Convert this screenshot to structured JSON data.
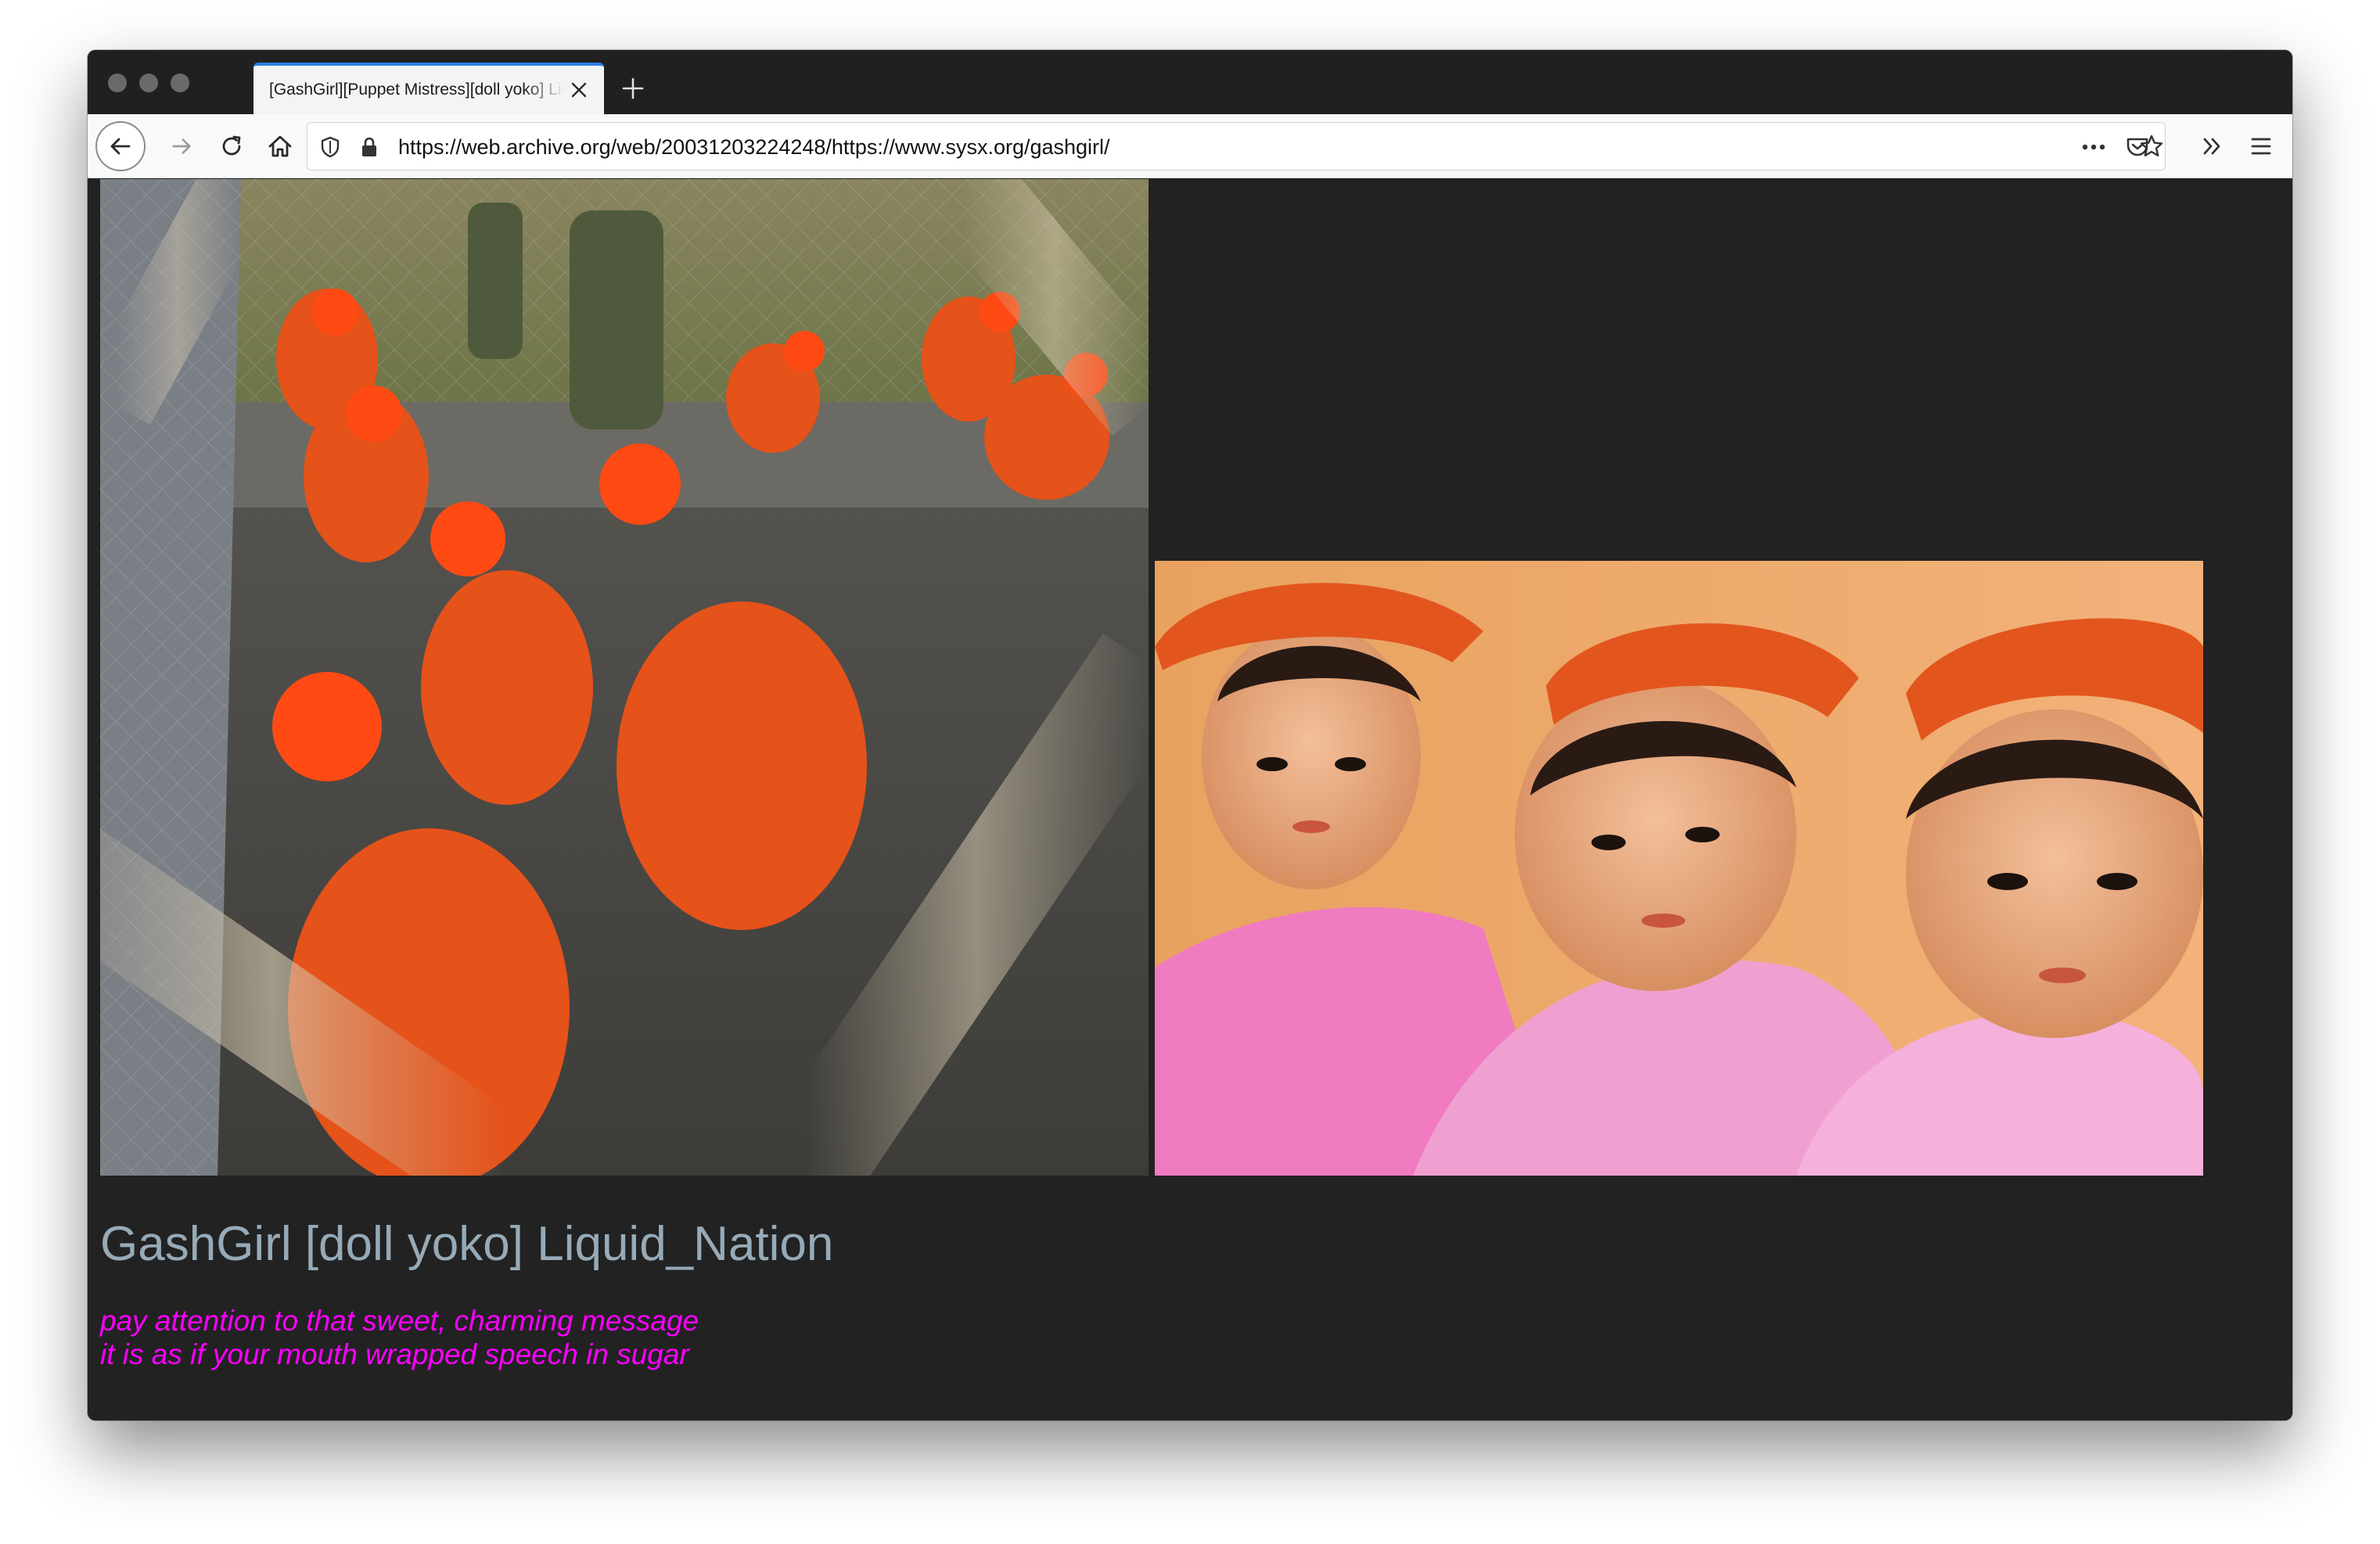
{
  "browser": {
    "tab_title": "[GashGirl][Puppet Mistress][doll yoko] Liquid_Nation",
    "url": "https://web.archive.org/web/20031203224248/https://www.sysx.org/gashgirl/",
    "icons": {
      "close": "close-icon",
      "new_tab": "plus-icon",
      "back": "arrow-left-icon",
      "forward": "arrow-right-icon",
      "reload": "reload-icon",
      "home": "home-icon",
      "tracking": "shield-icon",
      "lock": "lock-icon",
      "page_actions": "more-horizontal-icon",
      "pocket": "pocket-icon",
      "bookmark": "star-icon",
      "overflow": "chevrons-right-icon",
      "menu": "hamburger-menu-icon"
    }
  },
  "page": {
    "background": "#222222",
    "headline": "GashGirl [doll yoko] Liquid_Nation",
    "headline_color": "#96aab8",
    "poem_lines": [
      "pay attention to that sweet, charming message",
      "it is as if your mouth wrapped speech in sugar"
    ],
    "poem_color": "#ff00ff"
  }
}
